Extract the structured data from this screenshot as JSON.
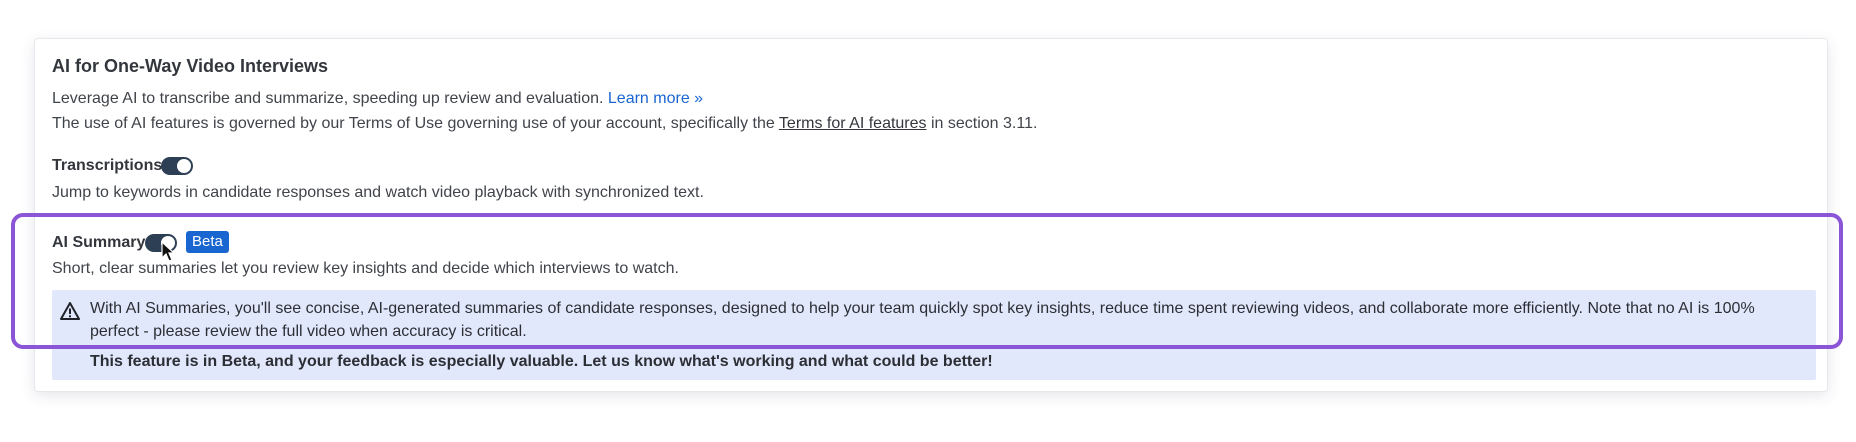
{
  "section": {
    "title": "AI for One-Way Video Interviews",
    "intro_text": "Leverage AI to transcribe and summarize, speeding up review and evaluation.",
    "learn_more": "Learn more »",
    "terms_prefix": "The use of AI features is governed by our Terms of Use governing use of your account, specifically the",
    "terms_link": "Terms for AI features",
    "terms_suffix": "in section 3.11."
  },
  "transcriptions": {
    "label": "Transcriptions",
    "enabled": true,
    "description": "Jump to keywords in candidate responses and watch video playback with synchronized text."
  },
  "ai_summary": {
    "label": "AI Summary",
    "enabled": true,
    "badge": "Beta",
    "description": "Short, clear summaries let you review key insights and decide which interviews to watch.",
    "alert_text": "With AI Summaries, you'll see concise, AI-generated summaries of candidate responses, designed to help your team quickly spot key insights, reduce time spent reviewing videos, and collaborate more efficiently. Note that no AI is 100% perfect - please review the full video when accuracy is critical.",
    "alert_bold": "This feature is in Beta, and your feedback is especially valuable. Let us know what's working and what could be better!"
  },
  "colors": {
    "accent": "#1a66d1",
    "toggle_on": "#2d3f54",
    "alert_bg": "#e2e8fb",
    "highlight": "#8a55d6"
  },
  "icons": {
    "alert": "warning-triangle-icon",
    "cursor": "mouse-pointer-icon"
  }
}
